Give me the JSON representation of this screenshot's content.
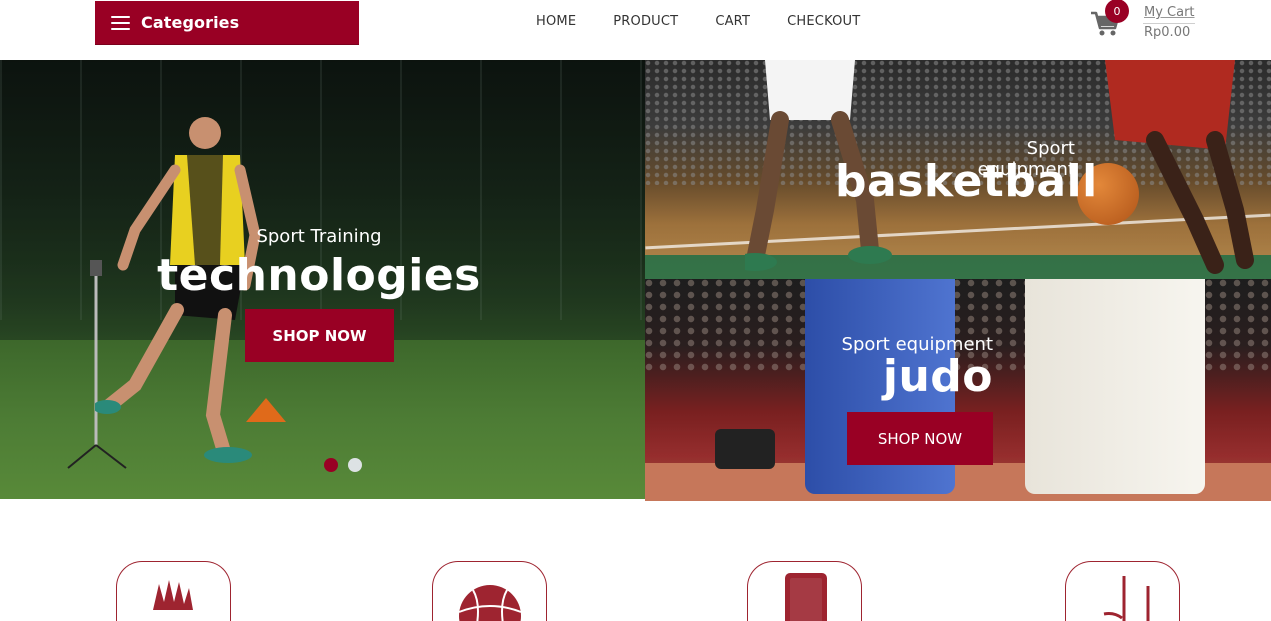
{
  "header": {
    "categories_label": "Categories",
    "nav": [
      "HOME",
      "PRODUCT",
      "CART",
      "CHECKOUT"
    ],
    "cart": {
      "count": "0",
      "label": "My Cart",
      "total": "Rp0.00"
    }
  },
  "hero_main": {
    "subtitle": "Sport Training",
    "title": "technologies",
    "button": "SHOP NOW",
    "slides": 2,
    "active_slide": 1
  },
  "hero_top_right": {
    "subtitle": "Sport equipment",
    "title": "basketball"
  },
  "hero_bottom_right": {
    "subtitle": "Sport equipment",
    "title": "judo",
    "button": "SHOP NOW"
  },
  "category_icons": [
    "shuttlecock-icon",
    "basketball-icon",
    "phone-icon",
    "hockey-stick-icon"
  ],
  "colors": {
    "accent": "#990024",
    "icon_border": "#9e2430",
    "dot_inactive": "#dde2e4"
  }
}
